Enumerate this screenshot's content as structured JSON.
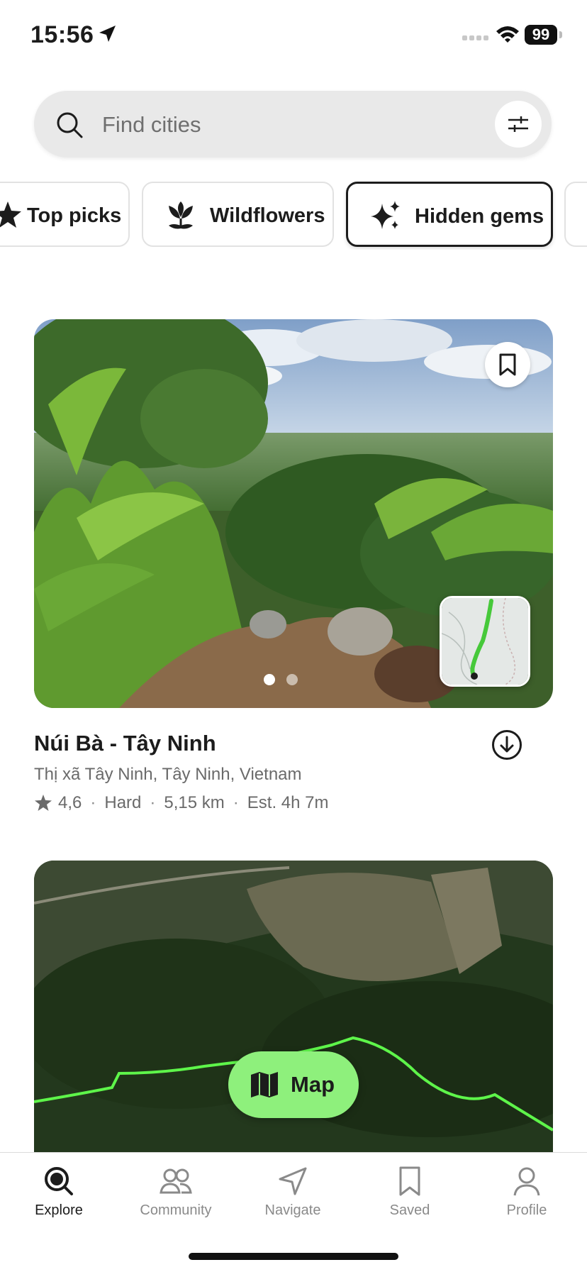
{
  "status": {
    "time": "15:56",
    "battery": "99"
  },
  "search": {
    "placeholder": "Find cities"
  },
  "chips": [
    {
      "label": "Top picks",
      "icon": "star-icon",
      "active": false
    },
    {
      "label": "Wildflowers",
      "icon": "flower-icon",
      "active": false
    },
    {
      "label": "Hidden gems",
      "icon": "sparkles-icon",
      "active": true
    }
  ],
  "trail": {
    "name": "Núi Bà - Tây Ninh",
    "location": "Thị xã Tây Ninh, Tây Ninh, Vietnam",
    "rating": "4,6",
    "difficulty": "Hard",
    "distance": "5,15 km",
    "duration": "Est. 4h 7m",
    "photo_pages": 2,
    "current_photo": 1
  },
  "map_button": {
    "label": "Map"
  },
  "tabs": [
    {
      "label": "Explore",
      "icon": "search-icon",
      "active": true
    },
    {
      "label": "Community",
      "icon": "people-icon",
      "active": false
    },
    {
      "label": "Navigate",
      "icon": "navigate-icon",
      "active": false
    },
    {
      "label": "Saved",
      "icon": "bookmark-icon",
      "active": false
    },
    {
      "label": "Profile",
      "icon": "person-icon",
      "active": false
    }
  ],
  "colors": {
    "accent_green": "#8ef07c",
    "trail_green": "#5ef54a",
    "text": "#1c1c1c",
    "muted": "#6a6a6a"
  }
}
